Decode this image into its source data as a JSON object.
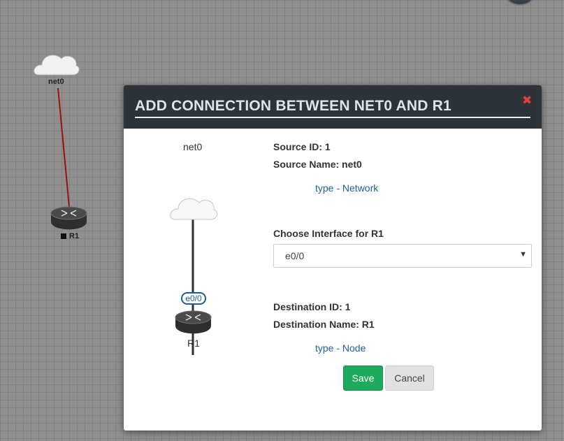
{
  "canvas": {
    "source_node_label": "net0",
    "dest_node_label": "R1",
    "link_color": "#9b1111"
  },
  "modal": {
    "title": "ADD CONNECTION BETWEEN NET0 AND R1",
    "close_icon": "close-x-icon",
    "diagram": {
      "source_label": "net0",
      "dest_label": "R1",
      "interface_badge": "e0/0"
    },
    "source": {
      "id_text": "Source ID: 1",
      "name_text": "Source Name: net0",
      "type_prefix": "type",
      "type_value": " - Network"
    },
    "interface": {
      "label": "Choose Interface for R1",
      "selected": "e0/0"
    },
    "destination": {
      "id_text": "Destination ID: 1",
      "name_text": "Destination Name: R1",
      "type_prefix": "type",
      "type_value": " - Node"
    },
    "buttons": {
      "save": "Save",
      "cancel": "Cancel"
    }
  },
  "colors": {
    "header_bg": "#2d3338",
    "save_bg": "#1daa5c",
    "cancel_bg": "#e1e1e1",
    "link_text": "#1f5f9c",
    "close": "#e2403e"
  }
}
